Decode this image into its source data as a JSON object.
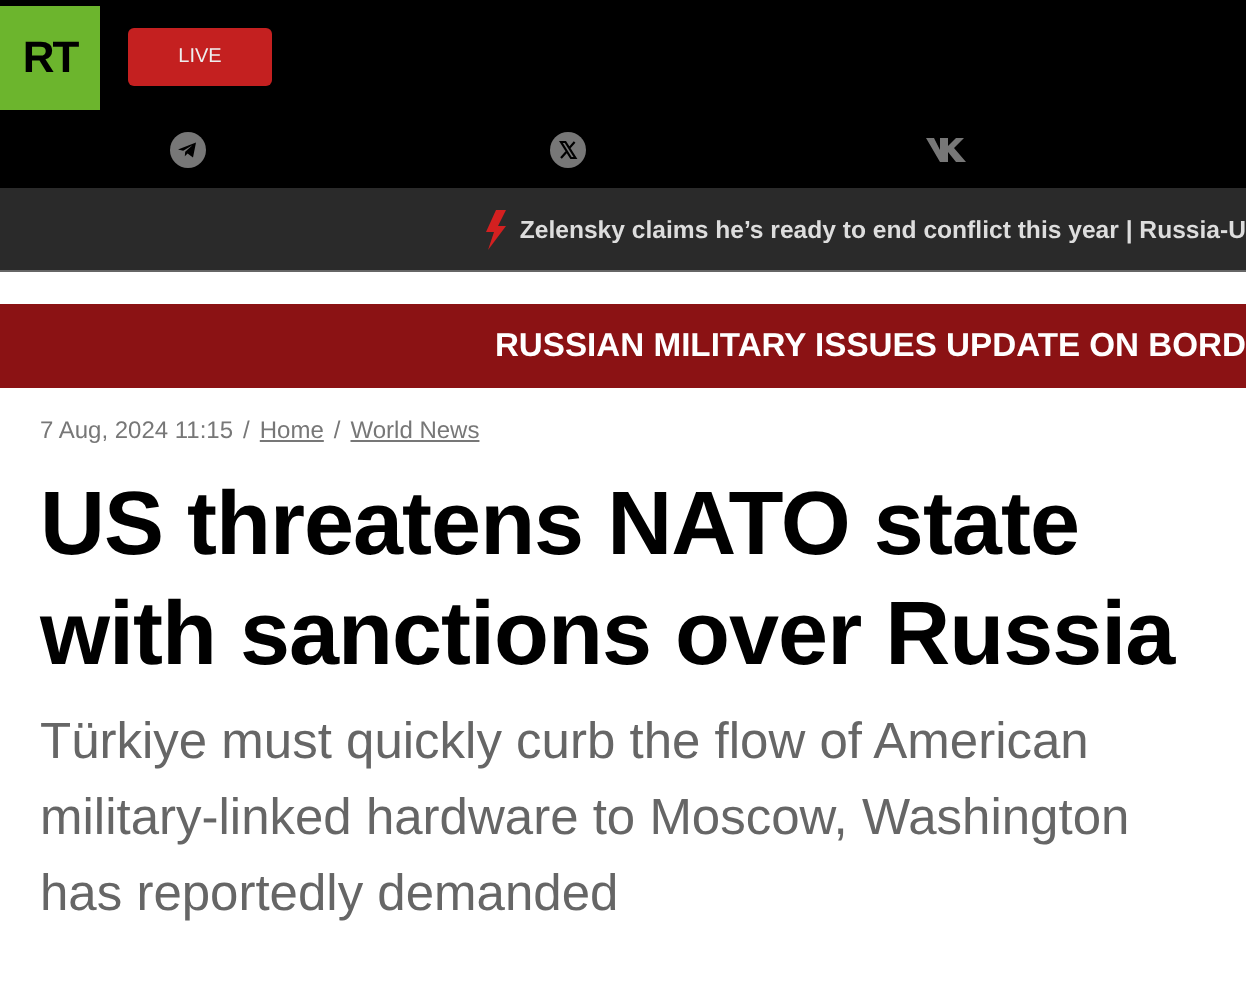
{
  "header": {
    "logo": "RT",
    "live_button": "LIVE"
  },
  "ticker": {
    "text": "Zelensky claims he’s ready to end conflict this year | Russia-U"
  },
  "banner": {
    "text": "RUSSIAN MILITARY ISSUES UPDATE ON BORD"
  },
  "breadcrumb": {
    "date": "7 Aug, 2024 11:15",
    "links": [
      {
        "separator": "/",
        "label": "Home"
      },
      {
        "separator": "/",
        "label": "World News"
      }
    ]
  },
  "article": {
    "headline": "US threatens NATO state with sanctions over Russia",
    "summary": "Türkiye must quickly curb the flow of American military-linked hardware to Moscow, Washington has reportedly demanded"
  }
}
